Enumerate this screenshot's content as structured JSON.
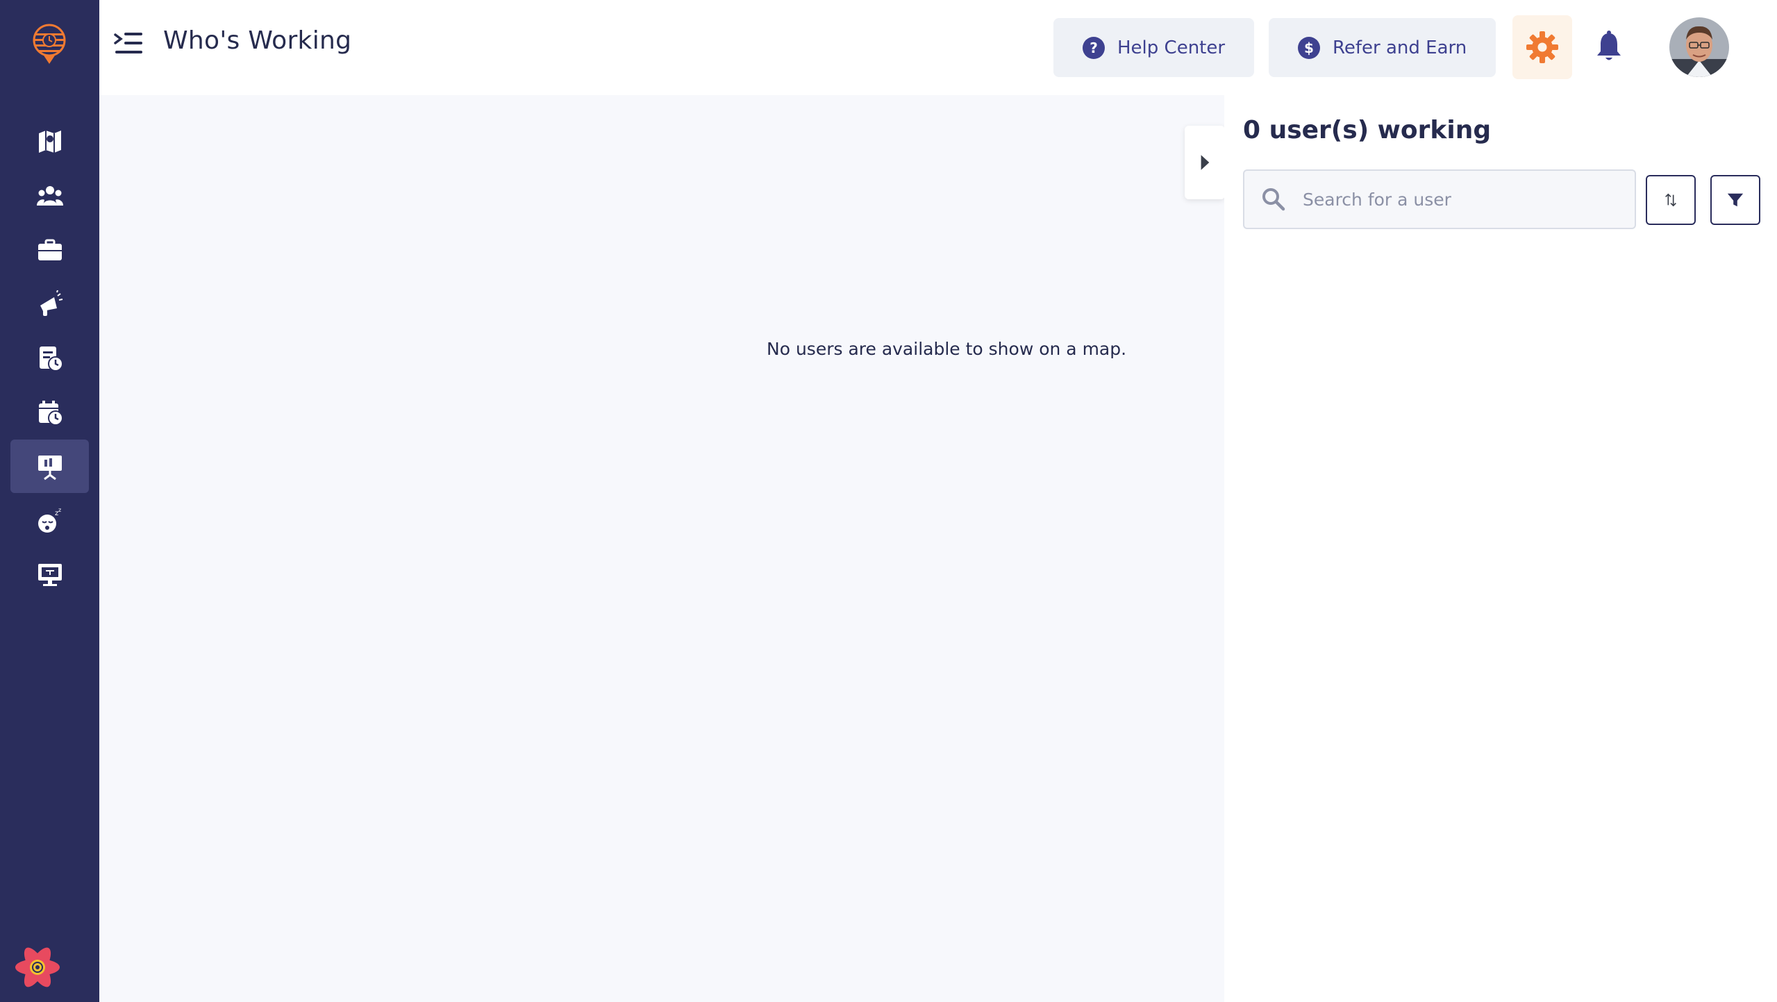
{
  "header": {
    "title": "Who's Working",
    "help_center_label": "Help Center",
    "refer_label": "Refer and Earn"
  },
  "sidebar": {
    "items": [
      {
        "icon": "map-icon"
      },
      {
        "icon": "team-icon"
      },
      {
        "icon": "briefcase-icon"
      },
      {
        "icon": "megaphone-icon"
      },
      {
        "icon": "timesheet-icon"
      },
      {
        "icon": "calendar-clock-icon"
      },
      {
        "icon": "presentation-icon",
        "active": true
      },
      {
        "icon": "sleep-icon"
      },
      {
        "icon": "monitor-icon"
      }
    ]
  },
  "map": {
    "empty_message": "No users are available to show on a map."
  },
  "panel": {
    "heading": "0 user(s) working",
    "search_placeholder": "Search for a user"
  },
  "colors": {
    "sidebar": "#2a2d5c",
    "accent": "#3e4190",
    "orange": "#f07a32",
    "map_bg": "#f7f8fc"
  }
}
